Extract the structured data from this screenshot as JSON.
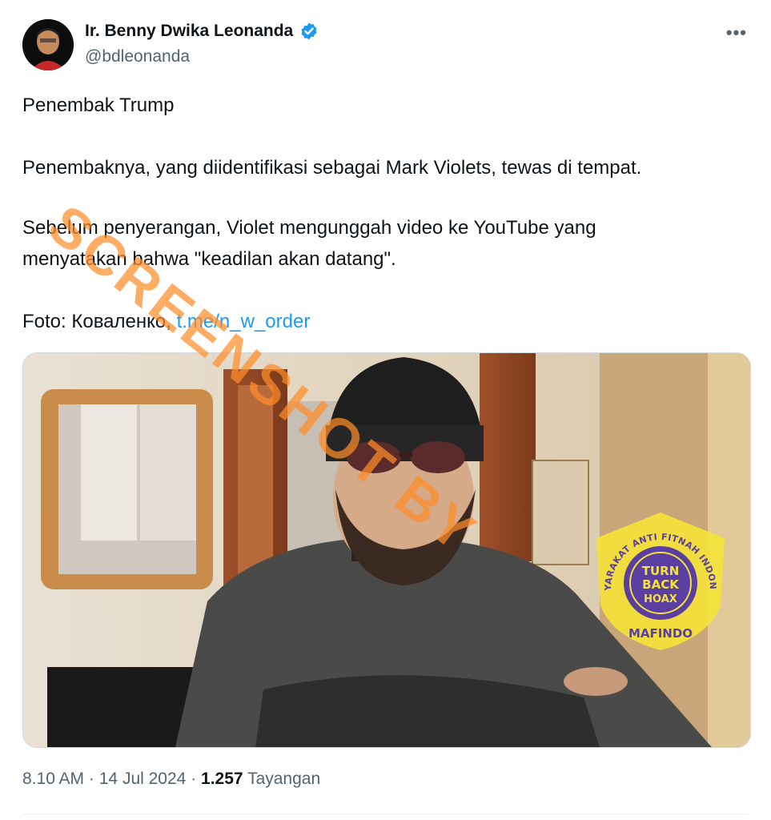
{
  "author": {
    "name": "Ir. Benny Dwika Leonanda",
    "handle": "@bdleonanda"
  },
  "tweet": {
    "line1": "Penembak Trump",
    "line2": "Penembaknya, yang diidentifikasi sebagai Mark Violets, tewas di tempat.",
    "line3": "Sebelum penyerangan, Violet mengunggah video ke YouTube yang",
    "line4": "menyatakan bahwa \"keadilan akan datang\".",
    "photo_credit_prefix": "Foto: Коваленко,",
    "photo_credit_link": "t.me/n_w_order"
  },
  "meta": {
    "time": "8.10 AM",
    "sep1": "·",
    "date": "14 Jul 2024",
    "sep2": "·",
    "views": "1.257",
    "views_label": "Tayangan"
  },
  "overlay": {
    "watermark": "SCREENSHOT BY",
    "seal_ring": "MASYARAKAT ANTI FITNAH INDONESIA",
    "seal_center_1": "TURN",
    "seal_center_2": "BACK",
    "seal_center_3": "HOAX",
    "seal_bottom": "MAFINDO"
  },
  "icons": {
    "verified": "verified-badge-icon",
    "more": "more-options-icon"
  },
  "colors": {
    "link": "#1d9bf0",
    "verified": "#1d9bf0",
    "watermark": "#ff8c28",
    "seal": "#f4e23a",
    "seal_center": "#5b3fa0"
  }
}
